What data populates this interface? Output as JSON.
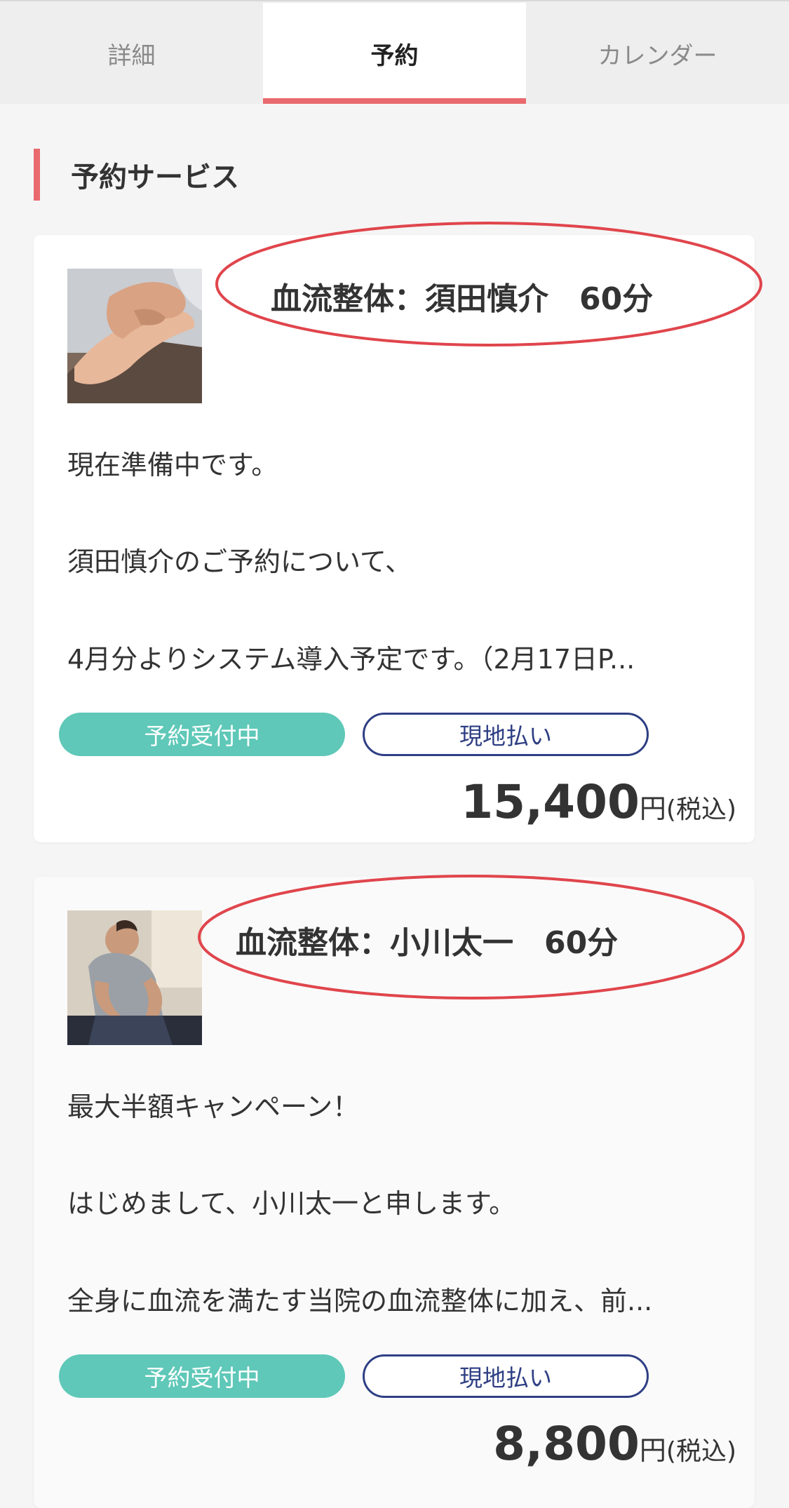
{
  "tabs": [
    {
      "label": "詳細",
      "active": false
    },
    {
      "label": "予約",
      "active": true
    },
    {
      "label": "カレンダー",
      "active": false
    }
  ],
  "section": {
    "title": "予約サービス"
  },
  "services": [
    {
      "title": "血流整体：須田慎介　60分",
      "thumbnail": "hand-massage-photo",
      "description": [
        "現在準備中です。",
        "須田慎介のご予約について、",
        "4月分よりシステム導入予定です。（2月17日P..."
      ],
      "status_badge": "予約受付中",
      "payment_badge": "現地払い",
      "price": "15,400",
      "price_unit": "円",
      "price_tax": "(税込)"
    },
    {
      "title": "血流整体：小川太一　60分",
      "thumbnail": "therapist-treatment-photo",
      "description": [
        "最大半額キャンペーン！",
        "はじめまして、小川太一と申します。",
        "全身に血流を満たす当院の血流整体に加え、前..."
      ],
      "status_badge": "予約受付中",
      "payment_badge": "現地払い",
      "price": "8,800",
      "price_unit": "円",
      "price_tax": "(税込)"
    }
  ],
  "colors": {
    "accent": "#e96a6e",
    "badge_open": "#5fc8b8",
    "badge_pay_border": "#2f3f84",
    "annotation_ellipse": "#e0454c"
  }
}
